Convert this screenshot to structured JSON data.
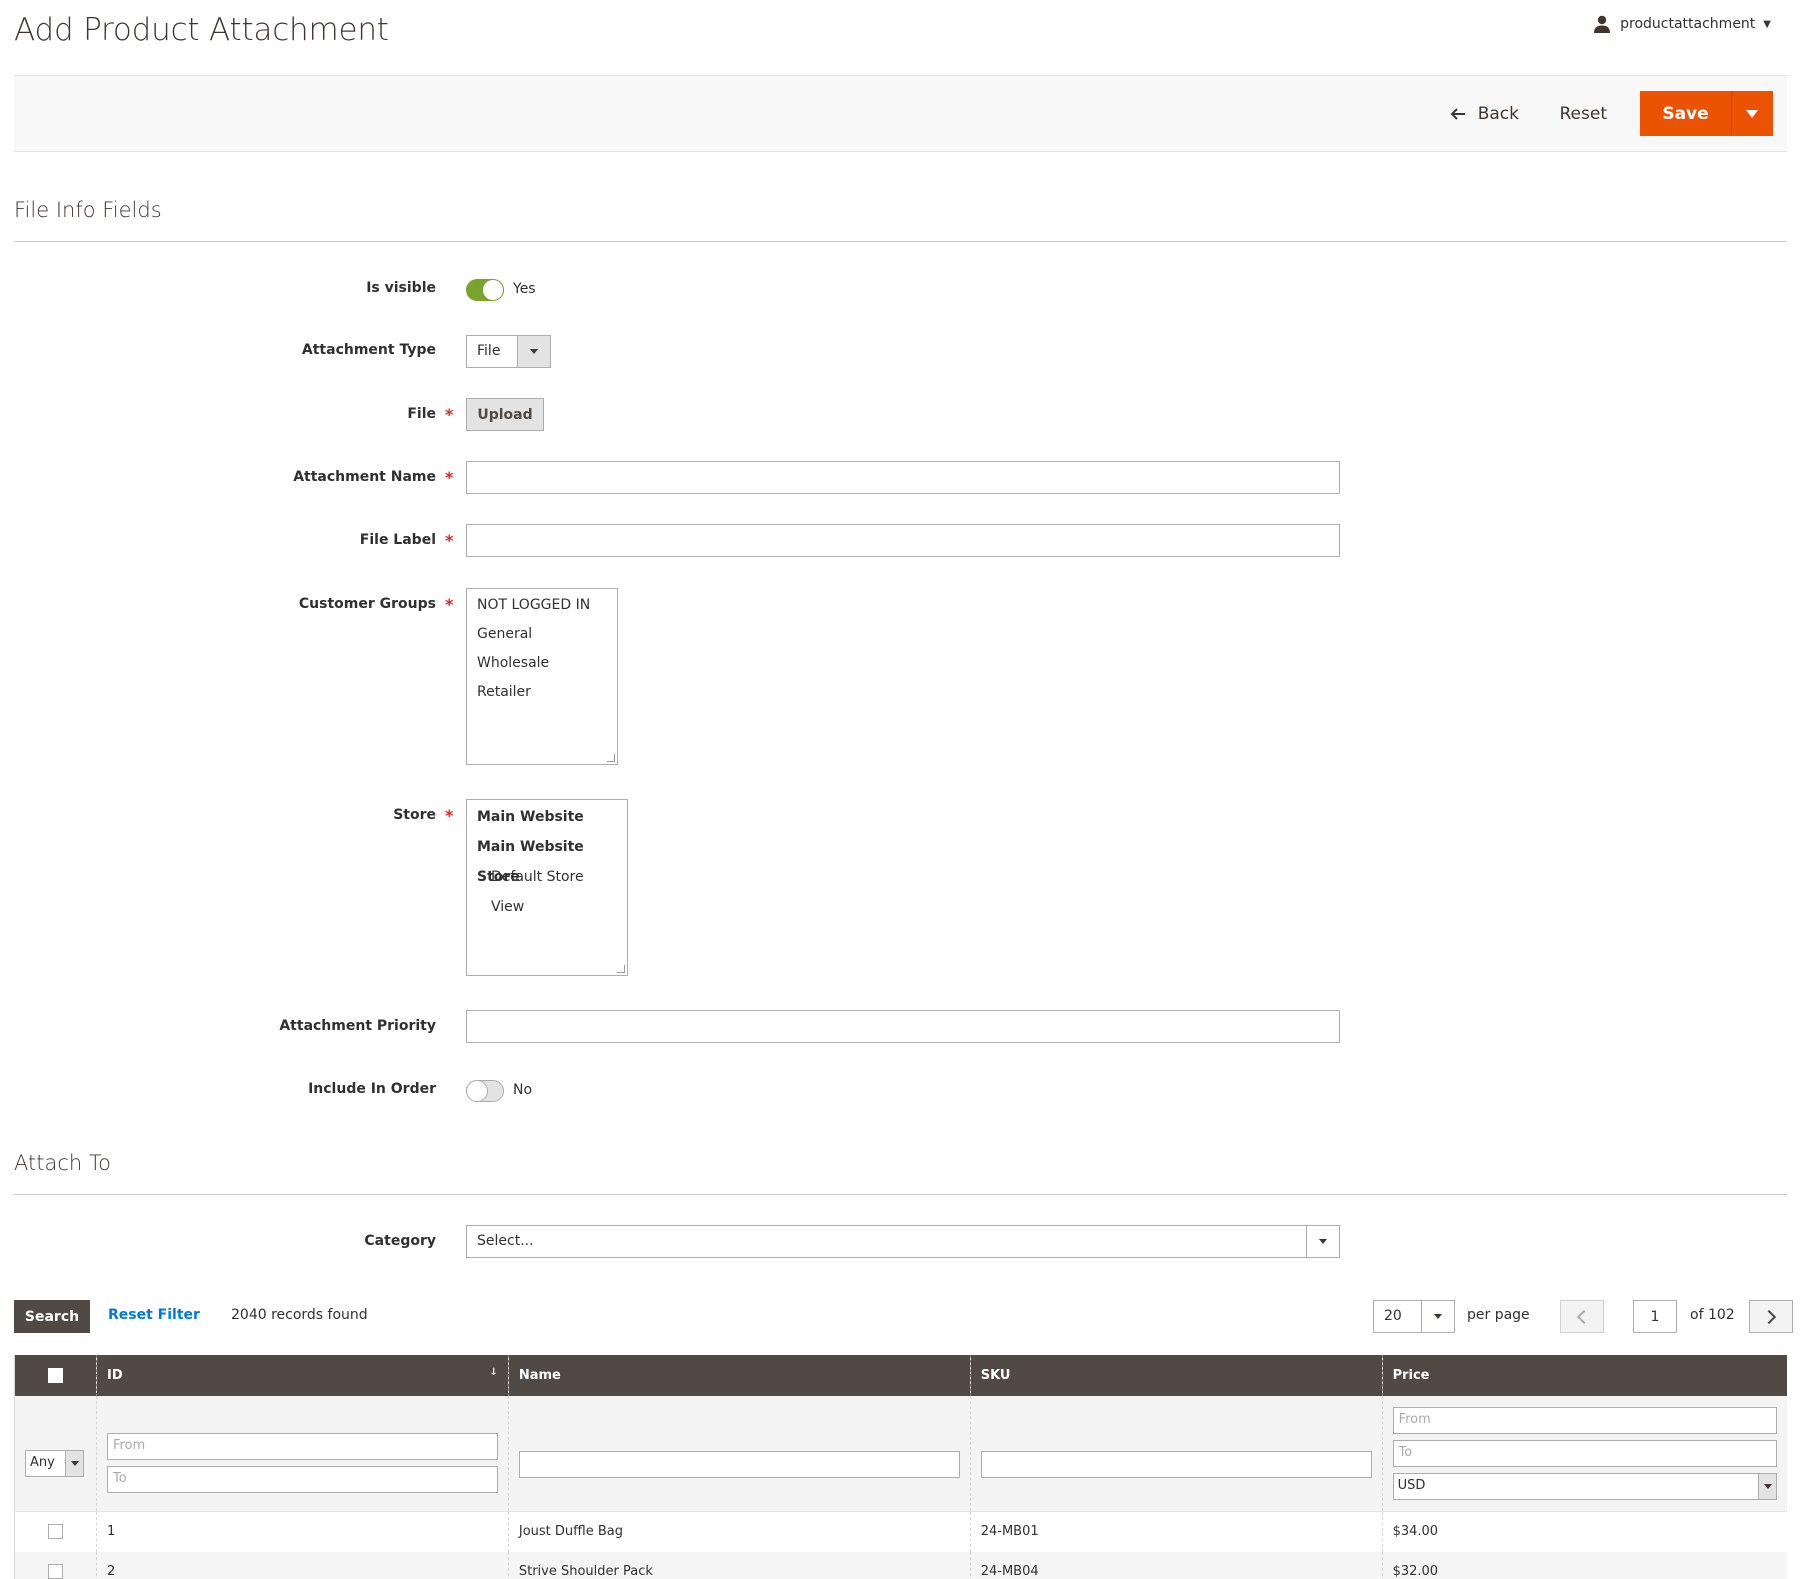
{
  "header": {
    "title": "Add Product Attachment",
    "username": "productattachment"
  },
  "actions": {
    "back_label": "Back",
    "reset_label": "Reset",
    "save_label": "Save"
  },
  "file_info": {
    "section_title": "File Info Fields",
    "is_visible": {
      "label": "Is visible",
      "value": "Yes",
      "state": "on"
    },
    "attachment_type": {
      "label": "Attachment Type",
      "value": "File"
    },
    "file": {
      "label": "File",
      "button": "Upload",
      "required": "*"
    },
    "attachment_name": {
      "label": "Attachment Name",
      "value": "",
      "required": "*"
    },
    "file_label": {
      "label": "File Label",
      "value": "",
      "required": "*"
    },
    "customer_groups": {
      "label": "Customer Groups",
      "required": "*",
      "options": [
        "NOT LOGGED IN",
        "General",
        "Wholesale",
        "Retailer"
      ]
    },
    "store": {
      "label": "Store",
      "required": "*",
      "options": [
        {
          "text": "Main Website"
        },
        {
          "text": "Main Website Store"
        },
        {
          "text": "Default Store View"
        }
      ]
    },
    "attachment_priority": {
      "label": "Attachment Priority",
      "value": ""
    },
    "include_in_order": {
      "label": "Include In Order",
      "value": "No",
      "state": "off"
    }
  },
  "attach_to": {
    "section_title": "Attach To",
    "category": {
      "label": "Category",
      "value": "Select..."
    }
  },
  "grid": {
    "search_label": "Search",
    "reset_filter_label": "Reset Filter",
    "records_found": "2040 records found",
    "per_page_value": "20",
    "per_page_label": "per page",
    "current_page": "1",
    "total_pages_label": "of 102",
    "columns": [
      "ID",
      "Name",
      "SKU",
      "Price"
    ],
    "sort_indicator": "↓",
    "filters": {
      "select_any": "Any",
      "id_from_placeholder": "From",
      "id_to_placeholder": "To",
      "price_from_placeholder": "From",
      "price_to_placeholder": "To",
      "currency": "USD"
    },
    "rows": [
      {
        "id": "1",
        "name": "Joust Duffle Bag",
        "sku": "24-MB01",
        "price": "$34.00"
      },
      {
        "id": "2",
        "name": "Strive Shoulder Pack",
        "sku": "24-MB04",
        "price": "$32.00"
      }
    ]
  }
}
